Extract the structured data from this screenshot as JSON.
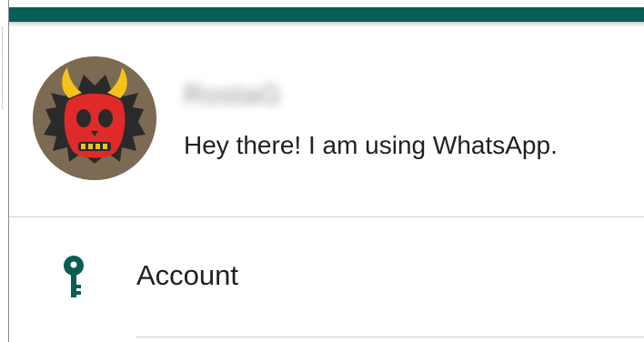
{
  "theme": {
    "toolbar_color": "#075e54",
    "icon_color": "#075e54"
  },
  "profile": {
    "name": "RostaG",
    "status": "Hey there! I am using WhatsApp.",
    "avatar_icon": "red-devil-mask-avatar"
  },
  "menu": {
    "items": [
      {
        "label": "Account",
        "icon": "key-icon"
      }
    ]
  }
}
